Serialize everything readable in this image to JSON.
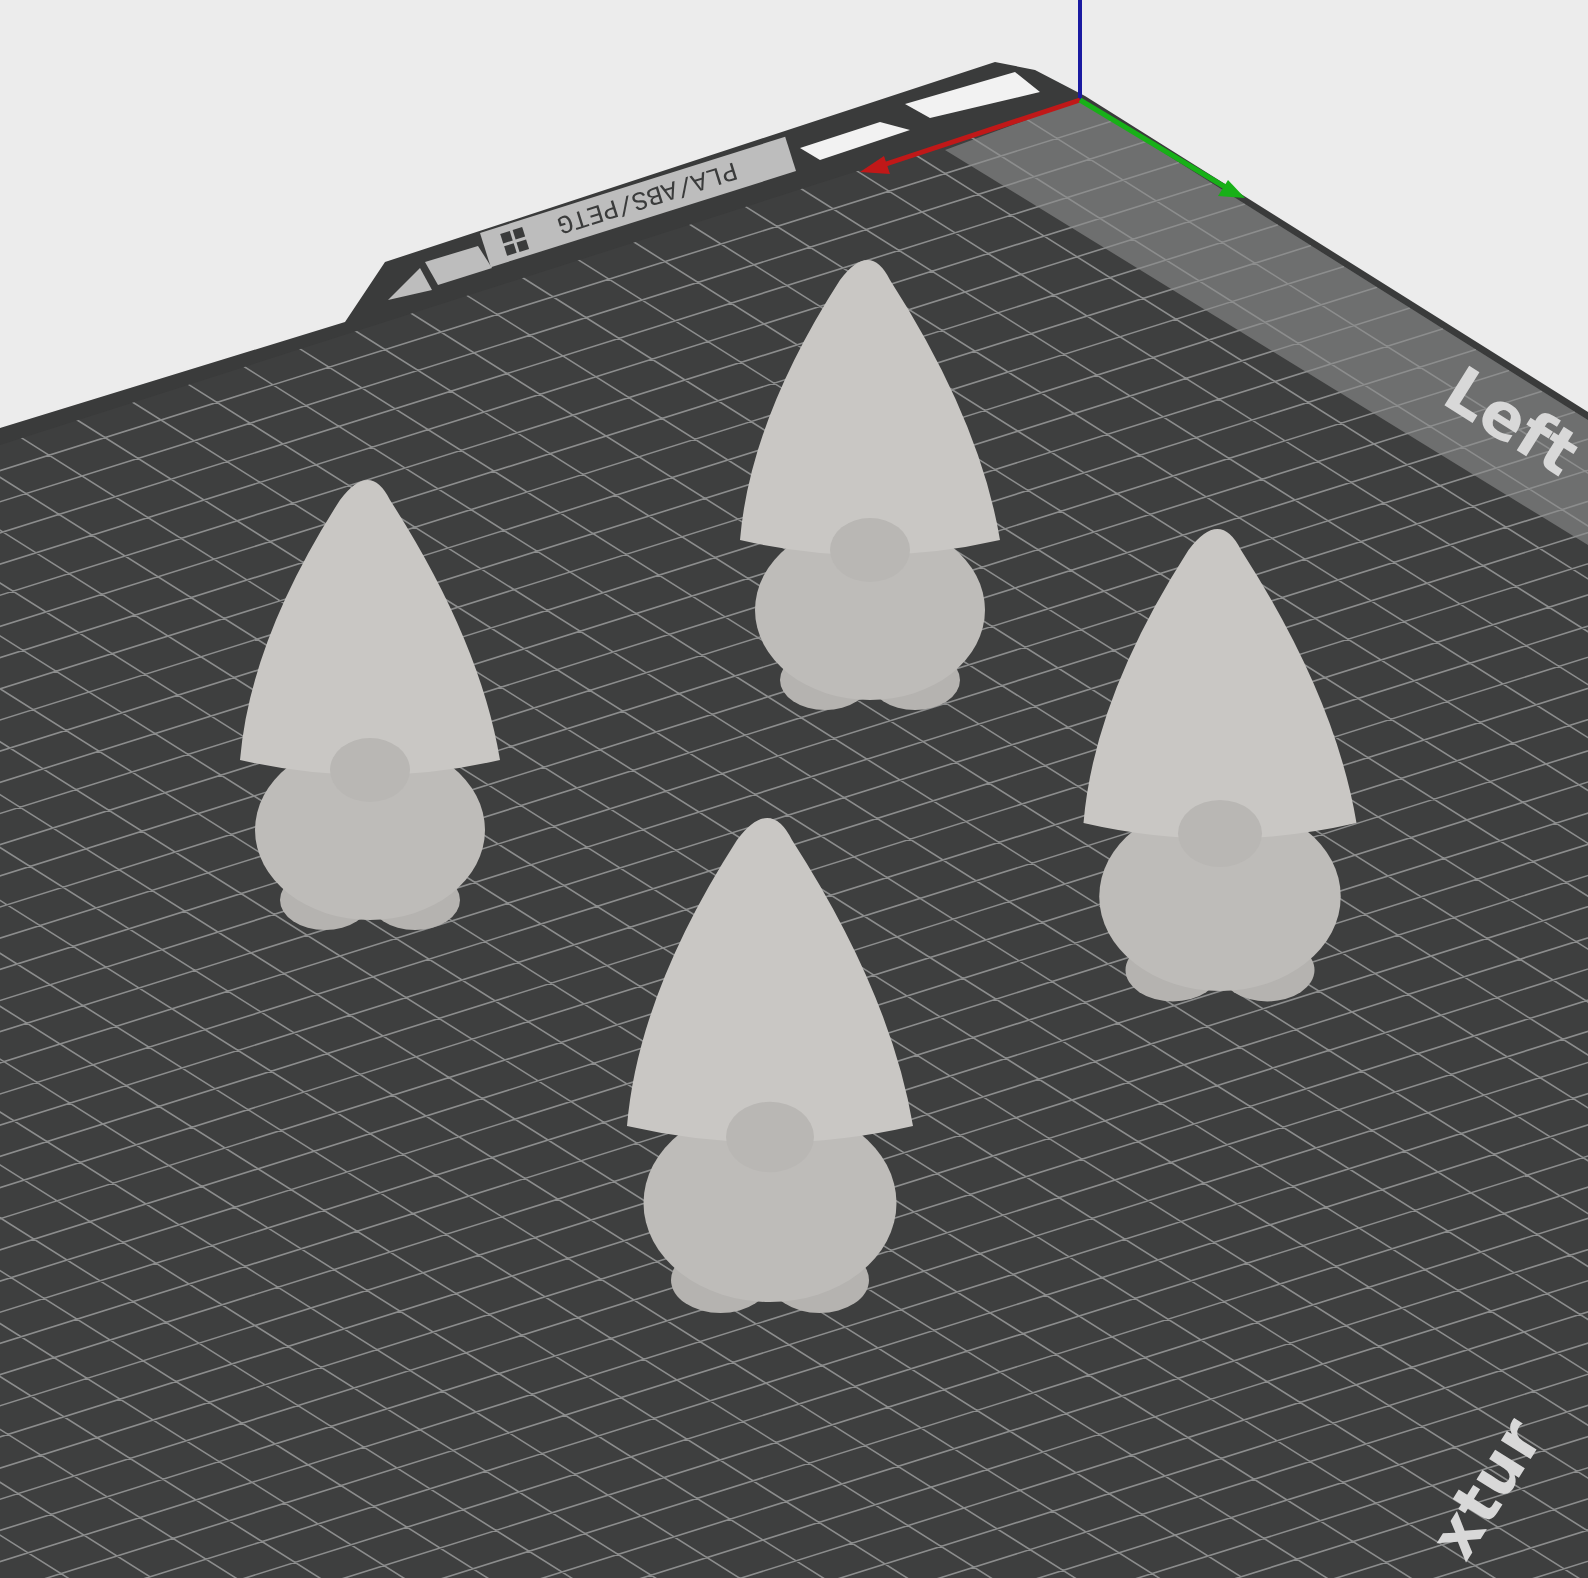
{
  "viewport": {
    "bed_label": "PLA/ABS/PETG",
    "zone_labels": [
      {
        "text": "Left",
        "kind": "far"
      },
      {
        "text": "xtur",
        "kind": "near"
      }
    ]
  }
}
